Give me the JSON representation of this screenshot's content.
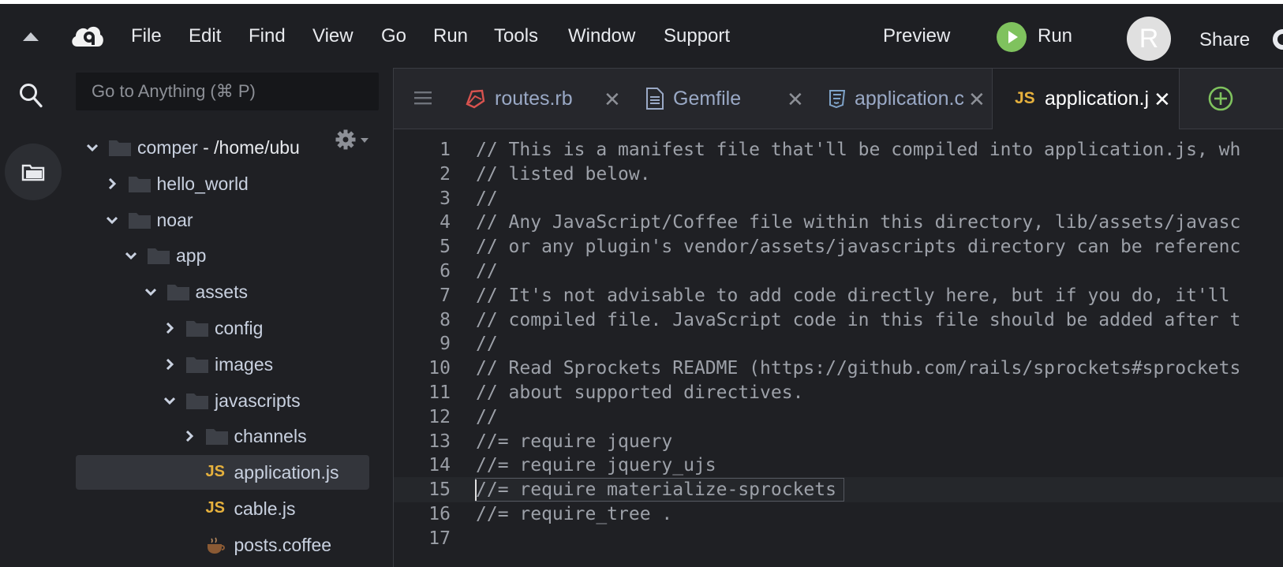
{
  "menubar": {
    "items": [
      "File",
      "Edit",
      "Find",
      "View",
      "Go",
      "Run",
      "Tools",
      "Window",
      "Support"
    ],
    "preview": "Preview",
    "run": "Run",
    "avatar_letter": "R",
    "share": "Share"
  },
  "sidebar": {
    "search_placeholder": "Go to Anything (⌘ P)",
    "tree": [
      {
        "label": "comper",
        "sub": " - /home/ubu",
        "type": "folder",
        "expanded": true,
        "depth": 0
      },
      {
        "label": "hello_world",
        "type": "folder",
        "expanded": false,
        "depth": 1
      },
      {
        "label": "noar",
        "type": "folder",
        "expanded": true,
        "depth": 1
      },
      {
        "label": "app",
        "type": "folder",
        "expanded": true,
        "depth": 2
      },
      {
        "label": "assets",
        "type": "folder",
        "expanded": true,
        "depth": 3
      },
      {
        "label": "config",
        "type": "folder",
        "expanded": false,
        "depth": 4
      },
      {
        "label": "images",
        "type": "folder",
        "expanded": false,
        "depth": 4
      },
      {
        "label": "javascripts",
        "type": "folder",
        "expanded": true,
        "depth": 4
      },
      {
        "label": "channels",
        "type": "folder",
        "expanded": false,
        "depth": 5
      },
      {
        "label": "application.js",
        "type": "js",
        "selected": true,
        "depth": 5
      },
      {
        "label": "cable.js",
        "type": "js",
        "depth": 5
      },
      {
        "label": "posts.coffee",
        "type": "coffee",
        "depth": 5
      }
    ]
  },
  "tabs": [
    {
      "label": "routes.rb",
      "icon": "ruby-icon",
      "active": false
    },
    {
      "label": "Gemfile",
      "icon": "file-icon",
      "active": false
    },
    {
      "label": "application.c",
      "icon": "css-icon",
      "active": false
    },
    {
      "label": "application.j",
      "icon": "js-icon",
      "icon_text": "JS",
      "active": true
    }
  ],
  "editor": {
    "current_line": 15,
    "lines": [
      {
        "n": "1",
        "text": "// This is a manifest file that'll be compiled into application.js, wh"
      },
      {
        "n": "2",
        "text": "// listed below."
      },
      {
        "n": "3",
        "text": "//"
      },
      {
        "n": "4",
        "text": "// Any JavaScript/Coffee file within this directory, lib/assets/javasc"
      },
      {
        "n": "5",
        "text": "// or any plugin's vendor/assets/javascripts directory can be referenc"
      },
      {
        "n": "6",
        "text": "//"
      },
      {
        "n": "7",
        "text": "// It's not advisable to add code directly here, but if you do, it'll"
      },
      {
        "n": "8",
        "text": "// compiled file. JavaScript code in this file should be added after t"
      },
      {
        "n": "9",
        "text": "//"
      },
      {
        "n": "10",
        "text": "// Read Sprockets README (https://github.com/rails/sprockets#sprockets"
      },
      {
        "n": "11",
        "text": "// about supported directives."
      },
      {
        "n": "12",
        "text": "//"
      },
      {
        "n": "13",
        "text": "//= require jquery"
      },
      {
        "n": "14",
        "text": "//= require jquery_ujs"
      },
      {
        "n": "15",
        "text": "//= require materialize-sprockets"
      },
      {
        "n": "16",
        "text": "//= require_tree ."
      },
      {
        "n": "17",
        "text": ""
      }
    ]
  },
  "colors": {
    "background": "#1f2024",
    "js_badge": "#e6b13d",
    "run_green": "#7fc25e",
    "tree_text": "#c9d1e0"
  }
}
